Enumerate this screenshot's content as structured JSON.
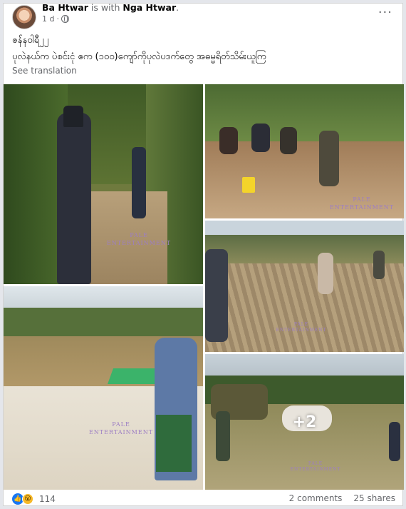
{
  "post": {
    "author": "Ba Htwar",
    "with_text": "is with",
    "tagged": "Nga Htwar",
    "time": "1 d",
    "dot": "·",
    "text_line1": "ဇန်နဝါရီ၂၂",
    "text_line2": "ပုလဲနယ်က  ပဲစင်းငုံ ဧက (၁၀၀)ကျော်ကိုပုလဲပဒက်တွေ အဓမ္မရိတ်သိမ်းယူကြ",
    "see_translation": "See translation",
    "more_icon": "···"
  },
  "photos": {
    "watermark_line1": "PALE",
    "watermark_line2": "ENTERTAINMENT",
    "more_count": "+2"
  },
  "footer": {
    "like_icon": "👍",
    "wow_icon": "😮",
    "reaction_count": "114",
    "comments": "2 comments",
    "shares": "25 shares"
  },
  "colors": {
    "link_blue": "#1877f2",
    "secondary_text": "#65676b",
    "watermark": "#9d7ec4"
  }
}
